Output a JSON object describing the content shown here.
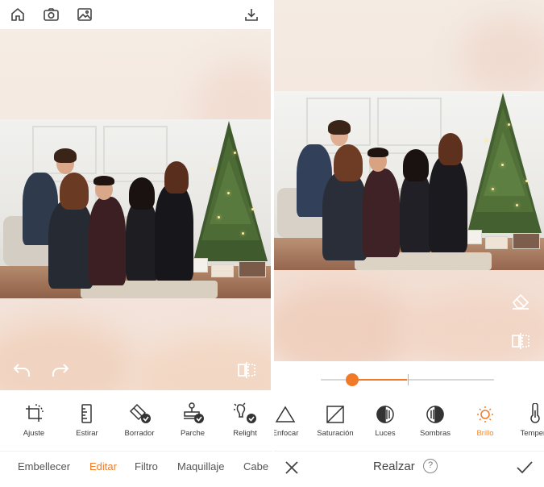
{
  "left_screen": {
    "top_bar": {
      "icons": [
        "home-icon",
        "camera-icon",
        "gallery-icon",
        "download-icon"
      ]
    },
    "canvas": {
      "undo_icon": "undo-icon",
      "redo_icon": "redo-icon",
      "compare_icon": "compare-icon"
    },
    "tools": [
      {
        "label": "Ajuste",
        "icon": "crop-rotate-icon"
      },
      {
        "label": "Estirar",
        "icon": "ruler-icon"
      },
      {
        "label": "Borrador",
        "icon": "eraser-icon"
      },
      {
        "label": "Parche",
        "icon": "stamp-icon"
      },
      {
        "label": "Relight",
        "icon": "relight-icon"
      }
    ],
    "bottom_nav": {
      "tabs": [
        "Embellecer",
        "Editar",
        "Filtro",
        "Maquillaje",
        "Cabe"
      ],
      "active": "Editar"
    }
  },
  "right_screen": {
    "canvas": {
      "eraser_icon": "eraser-icon",
      "compare_icon": "compare-icon"
    },
    "slider": {
      "value": 0.18,
      "center": 0.5
    },
    "tools": [
      {
        "label": "Enfocar",
        "icon": "triangle-icon"
      },
      {
        "label": "Saturación",
        "icon": "saturation-icon"
      },
      {
        "label": "Luces",
        "icon": "highlights-icon"
      },
      {
        "label": "Sombras",
        "icon": "shadows-icon"
      },
      {
        "label": "Brillo",
        "icon": "sun-icon",
        "active": true
      },
      {
        "label": "Tempera",
        "icon": "thermometer-icon"
      }
    ],
    "bottom_bar": {
      "title": "Realzar",
      "help_glyph": "?",
      "close_icon": "close-icon",
      "confirm_icon": "check-icon"
    }
  },
  "colors": {
    "accent": "#f07a28",
    "text": "#3a3a3a"
  }
}
